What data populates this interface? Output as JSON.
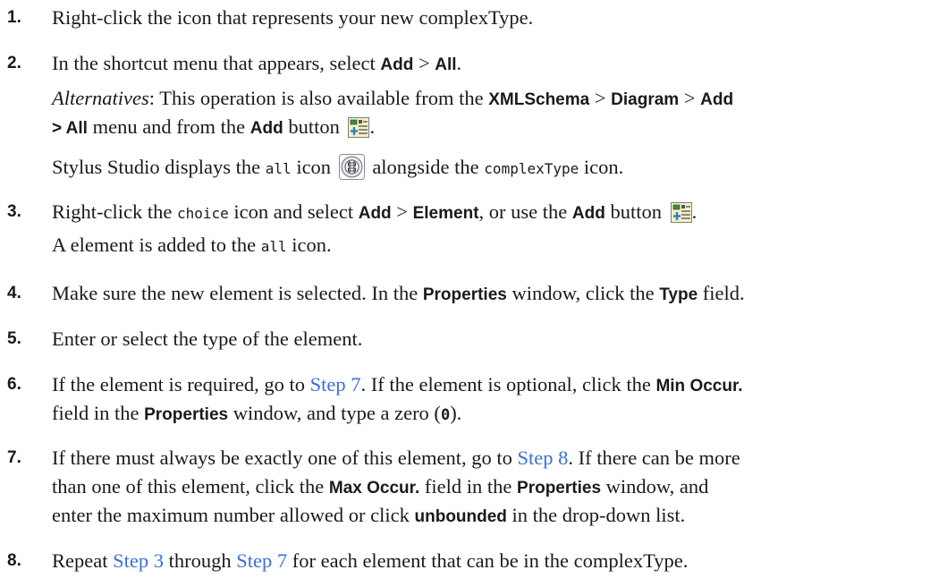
{
  "steps": [
    {
      "num": "1.",
      "text": "Right-click the icon that represents your new complexType."
    },
    {
      "num": "2.",
      "a": "In the shortcut menu that appears, select ",
      "b1": "Add",
      "gt": " > ",
      "b2": "All",
      "end": "."
    },
    {
      "num": "3.",
      "a": "Right-click the ",
      "code": "choice",
      "b": " icon and select ",
      "b1": "Add",
      "gt": " > ",
      "b2": "Element",
      "c": ", or use the ",
      "b3": "Add",
      "d": " button ",
      "end": "."
    },
    {
      "num": "4.",
      "a": "Make sure the new element is selected. In the ",
      "b1": "Properties",
      "b": " window, click the ",
      "b2": "Type",
      "c": " field."
    },
    {
      "num": "5.",
      "text": "Enter or select the type of the element."
    },
    {
      "num": "6.",
      "a": "If the element is required, go to ",
      "link": "Step 7",
      "b": ". If the element is optional, click the ",
      "b1": "Min Occur.",
      "line2a": "field in the ",
      "b2": "Properties",
      "line2b": " window, and type a zero (",
      "zero": "0",
      "line2c": ")."
    },
    {
      "num": "7.",
      "a": "If there must always be exactly one of this element, go to ",
      "link": "Step 8",
      "b": ". If there can be more",
      "line2a": "than one of this element, click the ",
      "b1": "Max Occur.",
      "line2b": " field in the ",
      "b2": "Properties",
      "line2c": " window, and",
      "line3a": "enter the maximum number allowed or click ",
      "b3": "unbounded",
      "line3b": " in the drop-down list."
    },
    {
      "num": "8.",
      "a": "Repeat ",
      "link1": "Step 3",
      "b": " through ",
      "link2": "Step 7",
      "c": " for each element that can be in the complexType."
    }
  ],
  "alternatives": {
    "label": "Alternatives",
    "a": ": This operation is also available from the ",
    "b1": "XMLSchema",
    "gt1": " > ",
    "b2": "Diagram",
    "gt2": " > ",
    "b3": "Add",
    "b4": "> All",
    "c": " menu and from the ",
    "b5": "Add",
    "d": " button ",
    "end": "."
  },
  "display_note": {
    "a": "Stylus Studio displays the ",
    "code1": "all",
    "b": " icon ",
    "c": " alongside the ",
    "code2": "complexType",
    "d": " icon."
  },
  "element_note": {
    "a": "A element is added to the ",
    "code": "all",
    "b": " icon."
  },
  "icons": {
    "add_button": "add-node-icon",
    "all_icon": "all-compositor-icon"
  }
}
